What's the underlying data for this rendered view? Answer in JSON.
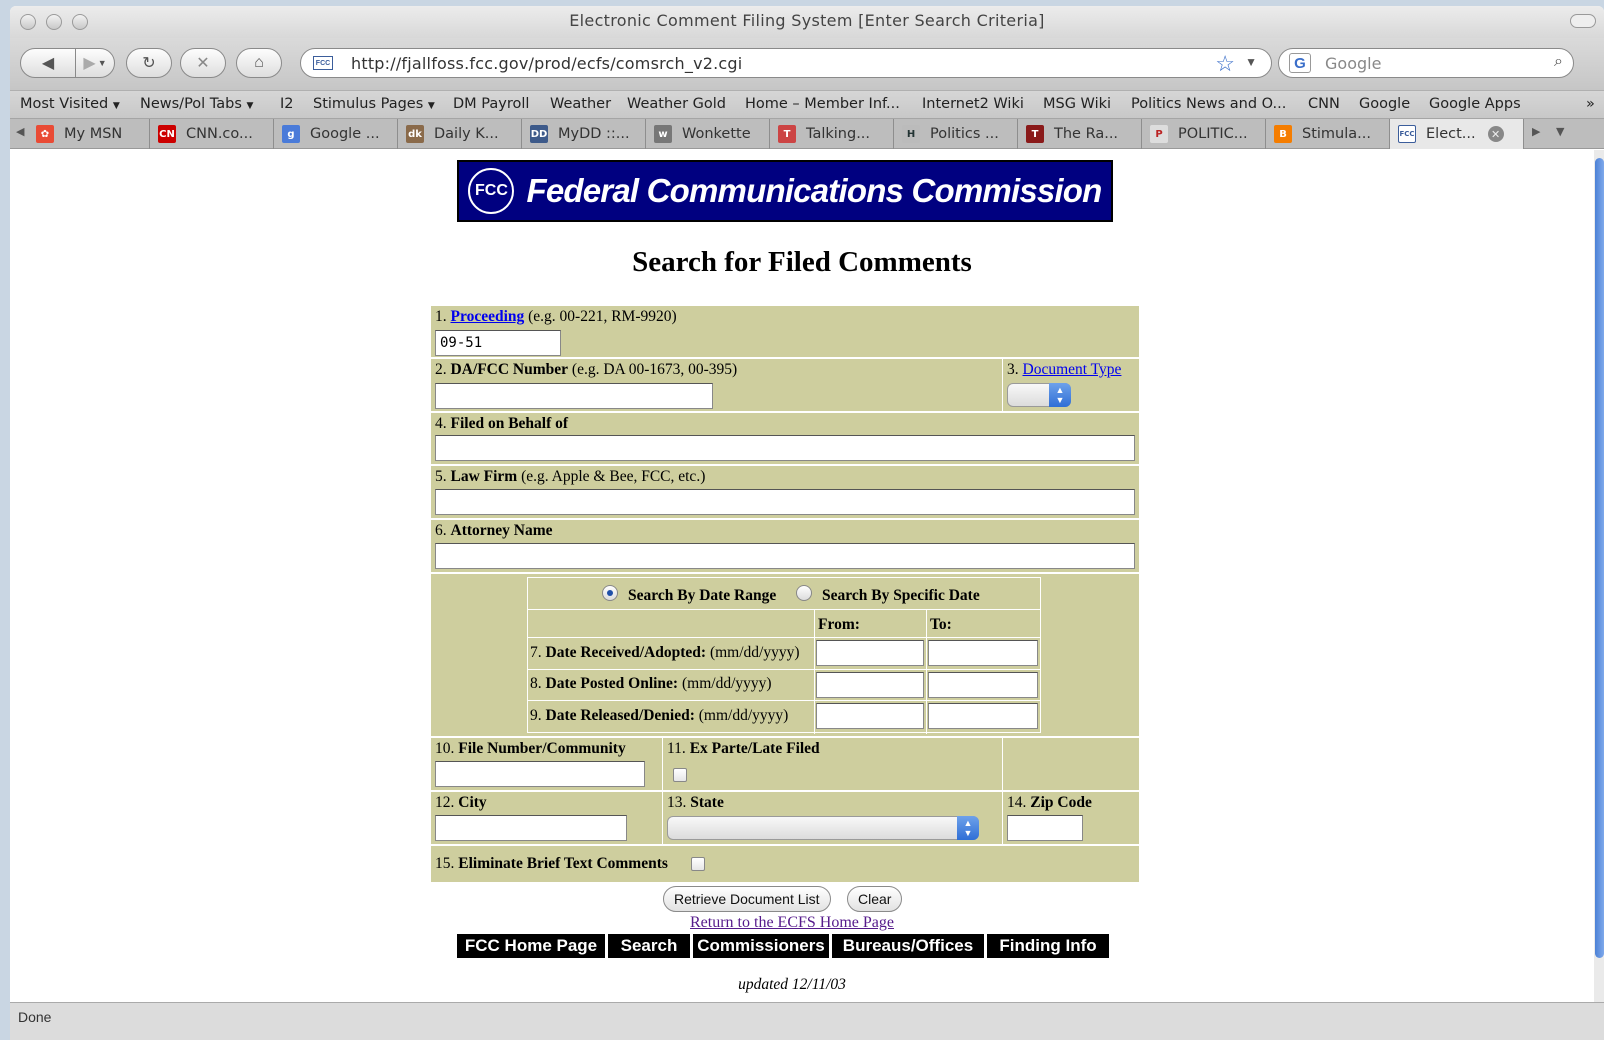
{
  "window": {
    "title": "Electronic Comment Filing System [Enter Search Criteria]"
  },
  "toolbar": {
    "url": "http://fjallfoss.fcc.gov/prod/ecfs/comsrch_v2.cgi",
    "search_placeholder": "Google",
    "icons": [
      "back-icon",
      "forward-icon",
      "history-dropdown-icon",
      "reload-icon",
      "stop-icon",
      "home-icon",
      "bookmark-star-icon",
      "magnifier-icon"
    ]
  },
  "bookmarks": [
    "Most Visited",
    "News/Pol Tabs",
    "I2",
    "Stimulus Pages",
    "DM Payroll",
    "Weather",
    "Weather Gold",
    "Home – Member Inf...",
    "Internet2 Wiki",
    "MSG Wiki",
    "Politics News and O...",
    "CNN",
    "Google",
    "Google Apps"
  ],
  "bookmarks_overflow": "»",
  "tabs": [
    "My MSN",
    "CNN.co...",
    "Google ...",
    "Daily K...",
    "MyDD ::...",
    "Wonkette",
    "Talking...",
    "Politics ...",
    "The Ra...",
    "POLITIC...",
    "Stimula...",
    "Elect..."
  ],
  "status": "Done",
  "page": {
    "banner_text": "Federal Communications Commission",
    "banner_seal": "FCC",
    "title": "Search for Filed Comments",
    "fields": {
      "f1_num": "1.",
      "f1_link": "Proceeding",
      "f1_hint": "(e.g. 00-221, RM-9920)",
      "f1_value": "09-51",
      "f2_num": "2.",
      "f2_label": "DA/FCC Number",
      "f2_hint": "(e.g. DA 00-1673, 00-395)",
      "f3_num": "3.",
      "f3_link": "Document Type",
      "f4_num": "4.",
      "f4_label": "Filed on Behalf of",
      "f5_num": "5.",
      "f5_label": "Law Firm",
      "f5_hint": "(e.g. Apple & Bee, FCC, etc.)",
      "f6_num": "6.",
      "f6_label": "Attorney Name",
      "radio_range": "Search By Date Range",
      "radio_specific": "Search By Specific Date",
      "from_label": "From:",
      "to_label": "To:",
      "f7_num": "7.",
      "f7_label": "Date Received/Adopted:",
      "f7_hint": "(mm/dd/yyyy)",
      "f8_num": "8.",
      "f8_label": "Date Posted Online:",
      "f8_hint": "(mm/dd/yyyy)",
      "f9_num": "9.",
      "f9_label": "Date Released/Denied:",
      "f9_hint": "(mm/dd/yyyy)",
      "f10_num": "10.",
      "f10_label": "File Number/Community",
      "f11_num": "11.",
      "f11_label": "Ex Parte/Late Filed",
      "f12_num": "12.",
      "f12_label": "City",
      "f13_num": "13.",
      "f13_label": "State",
      "f14_num": "14.",
      "f14_label": "Zip Code",
      "f15_num": "15.",
      "f15_label": "Eliminate Brief Text Comments"
    },
    "buttons": {
      "retrieve": "Retrieve Document List",
      "clear": "Clear"
    },
    "return_link": "Return to the ECFS Home Page",
    "nav": [
      "FCC Home Page",
      "Search",
      "Commissioners",
      "Bureaus/Offices",
      "Finding Info"
    ],
    "updated": "updated 12/11/03"
  }
}
